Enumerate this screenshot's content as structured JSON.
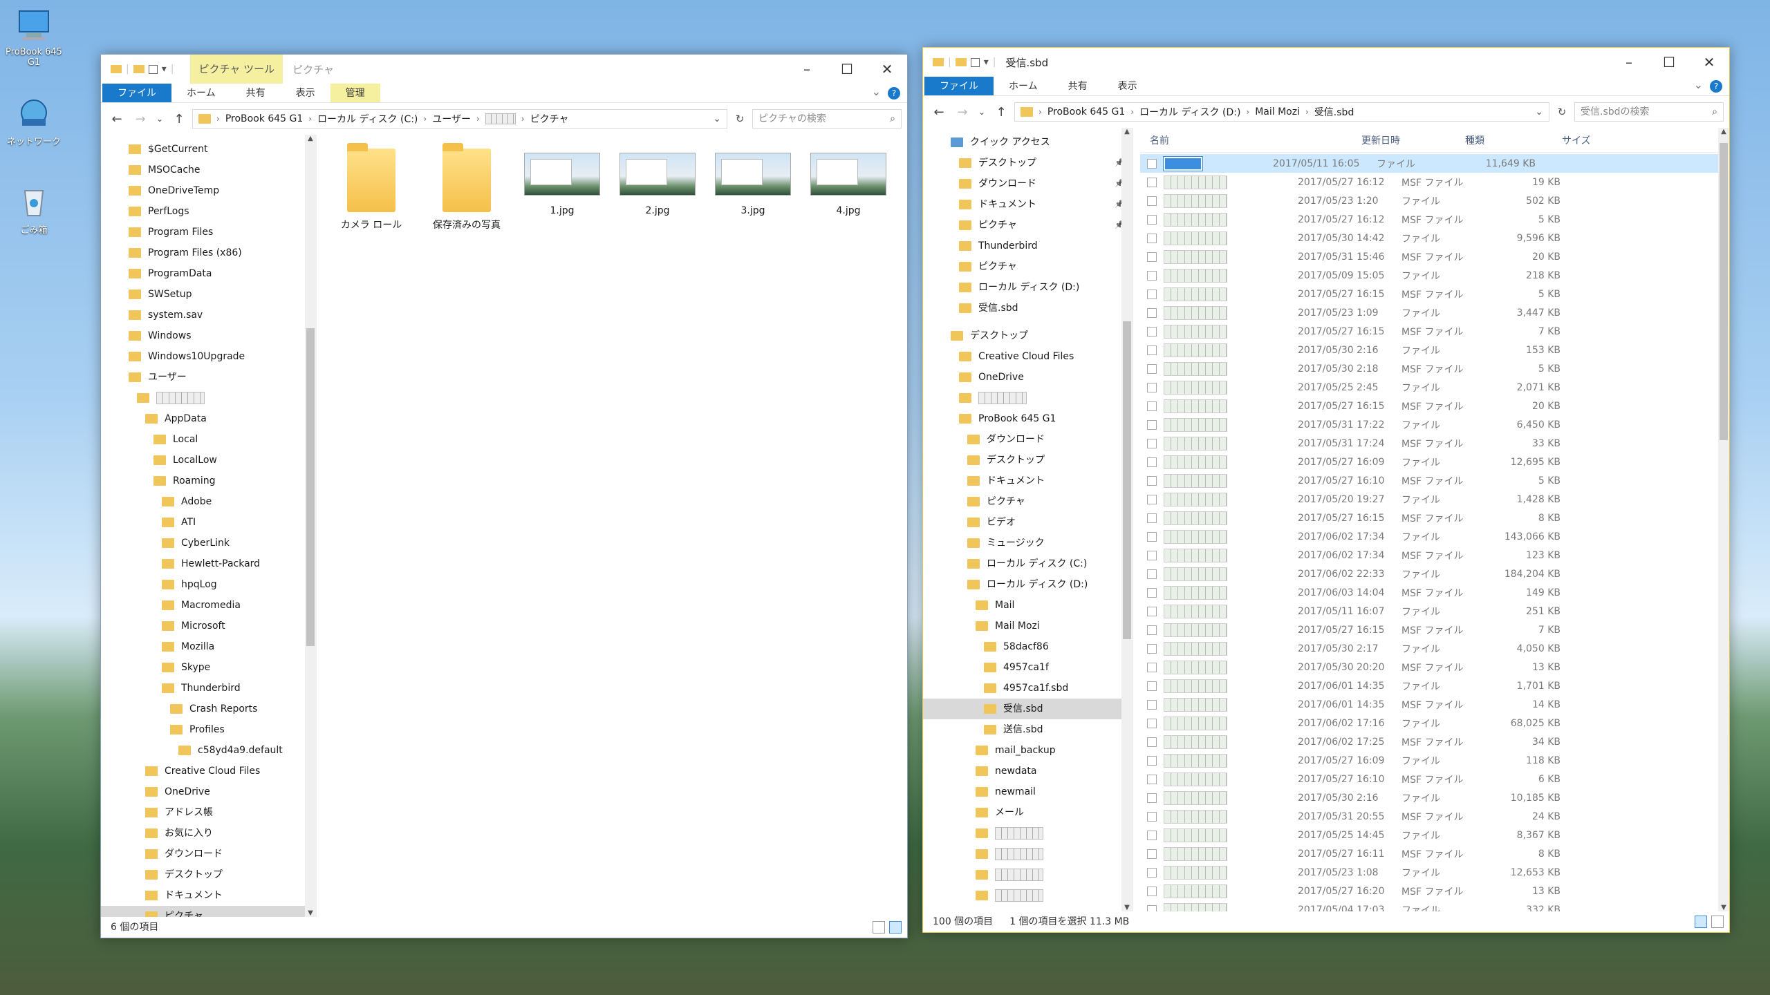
{
  "desktop": {
    "icons": [
      {
        "label": "ProBook 645 G1"
      },
      {
        "label": "ネットワーク"
      },
      {
        "label": "ごみ箱"
      }
    ]
  },
  "left_window": {
    "context_tab": "ピクチャ ツール",
    "title": "ピクチャ",
    "ribbon_tabs": [
      "ファイル",
      "ホーム",
      "共有",
      "表示",
      "管理"
    ],
    "address": [
      "ProBook 645 G1",
      "ローカル ディスク (C:)",
      "ユーザー",
      "ピクチャ"
    ],
    "search_placeholder": "ピクチャの検索",
    "tree": [
      {
        "label": "$GetCurrent",
        "level": 0
      },
      {
        "label": "MSOCache",
        "level": 0
      },
      {
        "label": "OneDriveTemp",
        "level": 0
      },
      {
        "label": "PerfLogs",
        "level": 0
      },
      {
        "label": "Program Files",
        "level": 0
      },
      {
        "label": "Program Files (x86)",
        "level": 0
      },
      {
        "label": "ProgramData",
        "level": 0
      },
      {
        "label": "SWSetup",
        "level": 0
      },
      {
        "label": "system.sav",
        "level": 0
      },
      {
        "label": "Windows",
        "level": 0
      },
      {
        "label": "Windows10Upgrade",
        "level": 0
      },
      {
        "label": "ユーザー",
        "level": 0
      },
      {
        "label": "",
        "level": 1,
        "blurred": true
      },
      {
        "label": "AppData",
        "level": 2
      },
      {
        "label": "Local",
        "level": 3
      },
      {
        "label": "LocalLow",
        "level": 3
      },
      {
        "label": "Roaming",
        "level": 3
      },
      {
        "label": "Adobe",
        "level": 4
      },
      {
        "label": "ATI",
        "level": 4
      },
      {
        "label": "CyberLink",
        "level": 4
      },
      {
        "label": "Hewlett-Packard",
        "level": 4
      },
      {
        "label": "hpqLog",
        "level": 4
      },
      {
        "label": "Macromedia",
        "level": 4
      },
      {
        "label": "Microsoft",
        "level": 4
      },
      {
        "label": "Mozilla",
        "level": 4
      },
      {
        "label": "Skype",
        "level": 4
      },
      {
        "label": "Thunderbird",
        "level": 4
      },
      {
        "label": "Crash Reports",
        "level": 5
      },
      {
        "label": "Profiles",
        "level": 5
      },
      {
        "label": "c58yd4a9.default",
        "level": 6
      },
      {
        "label": "Creative Cloud Files",
        "level": 2
      },
      {
        "label": "OneDrive",
        "level": 2
      },
      {
        "label": "アドレス帳",
        "level": 2
      },
      {
        "label": "お気に入り",
        "level": 2
      },
      {
        "label": "ダウンロード",
        "level": 2
      },
      {
        "label": "デスクトップ",
        "level": 2
      },
      {
        "label": "ドキュメント",
        "level": 2
      },
      {
        "label": "ピクチャ",
        "level": 2,
        "selected": true
      }
    ],
    "items": [
      {
        "label": "カメラ ロール",
        "kind": "folder"
      },
      {
        "label": "保存済みの写真",
        "kind": "folder"
      },
      {
        "label": "1.jpg",
        "kind": "image"
      },
      {
        "label": "2.jpg",
        "kind": "image"
      },
      {
        "label": "3.jpg",
        "kind": "image"
      },
      {
        "label": "4.jpg",
        "kind": "image"
      }
    ],
    "status": "6 個の項目"
  },
  "right_window": {
    "title": "受信.sbd",
    "ribbon_tabs": [
      "ファイル",
      "ホーム",
      "共有",
      "表示"
    ],
    "address": [
      "ProBook 645 G1",
      "ローカル ディスク (D:)",
      "Mail Mozi",
      "受信.sbd"
    ],
    "search_placeholder": "受信.sbdの検索",
    "tree": [
      {
        "label": "クイック アクセス",
        "level": 0,
        "icon": "star"
      },
      {
        "label": "デスクトップ",
        "level": 1,
        "pin": true
      },
      {
        "label": "ダウンロード",
        "level": 1,
        "pin": true
      },
      {
        "label": "ドキュメント",
        "level": 1,
        "pin": true
      },
      {
        "label": "ピクチャ",
        "level": 1,
        "pin": true
      },
      {
        "label": "Thunderbird",
        "level": 1
      },
      {
        "label": "ピクチャ",
        "level": 1
      },
      {
        "label": "ローカル ディスク (D:)",
        "level": 1
      },
      {
        "label": "受信.sbd",
        "level": 1
      },
      {
        "label": "",
        "level": -1
      },
      {
        "label": "デスクトップ",
        "level": 0
      },
      {
        "label": "Creative Cloud Files",
        "level": 1
      },
      {
        "label": "OneDrive",
        "level": 1
      },
      {
        "label": "",
        "level": 1,
        "blurred": true
      },
      {
        "label": "ProBook 645 G1",
        "level": 1
      },
      {
        "label": "ダウンロード",
        "level": 2
      },
      {
        "label": "デスクトップ",
        "level": 2
      },
      {
        "label": "ドキュメント",
        "level": 2
      },
      {
        "label": "ピクチャ",
        "level": 2
      },
      {
        "label": "ビデオ",
        "level": 2
      },
      {
        "label": "ミュージック",
        "level": 2
      },
      {
        "label": "ローカル ディスク (C:)",
        "level": 2
      },
      {
        "label": "ローカル ディスク (D:)",
        "level": 2
      },
      {
        "label": "Mail",
        "level": 3
      },
      {
        "label": "Mail Mozi",
        "level": 3
      },
      {
        "label": "58dacf86",
        "level": 4
      },
      {
        "label": "4957ca1f",
        "level": 4
      },
      {
        "label": "4957ca1f.sbd",
        "level": 4
      },
      {
        "label": "受信.sbd",
        "level": 4,
        "selected": true
      },
      {
        "label": "送信.sbd",
        "level": 4
      },
      {
        "label": "mail_backup",
        "level": 3
      },
      {
        "label": "newdata",
        "level": 3
      },
      {
        "label": "newmail",
        "level": 3
      },
      {
        "label": "メール",
        "level": 3
      },
      {
        "label": "",
        "level": 3,
        "blurred": true
      },
      {
        "label": "",
        "level": 3,
        "blurred": true
      },
      {
        "label": "",
        "level": 3,
        "blurred": true
      },
      {
        "label": "",
        "level": 3,
        "blurred": true
      }
    ],
    "columns": {
      "name": "名前",
      "date": "更新日時",
      "type": "種類",
      "size": "サイズ"
    },
    "rows": [
      {
        "date": "2017/05/11 16:05",
        "type": "ファイル",
        "size": "11,649 KB",
        "selected": true
      },
      {
        "date": "2017/05/27 16:12",
        "type": "MSF ファイル",
        "size": "19 KB"
      },
      {
        "date": "2017/05/23 1:20",
        "type": "ファイル",
        "size": "502 KB"
      },
      {
        "date": "2017/05/27 16:12",
        "type": "MSF ファイル",
        "size": "5 KB"
      },
      {
        "date": "2017/05/30 14:42",
        "type": "ファイル",
        "size": "9,596 KB"
      },
      {
        "date": "2017/05/31 15:46",
        "type": "MSF ファイル",
        "size": "20 KB"
      },
      {
        "date": "2017/05/09 15:05",
        "type": "ファイル",
        "size": "218 KB"
      },
      {
        "date": "2017/05/27 16:15",
        "type": "MSF ファイル",
        "size": "5 KB"
      },
      {
        "date": "2017/05/23 1:09",
        "type": "ファイル",
        "size": "3,447 KB"
      },
      {
        "date": "2017/05/27 16:15",
        "type": "MSF ファイル",
        "size": "7 KB"
      },
      {
        "date": "2017/05/30 2:16",
        "type": "ファイル",
        "size": "153 KB"
      },
      {
        "date": "2017/05/30 2:18",
        "type": "MSF ファイル",
        "size": "5 KB"
      },
      {
        "date": "2017/05/25 2:45",
        "type": "ファイル",
        "size": "2,071 KB"
      },
      {
        "date": "2017/05/27 16:15",
        "type": "MSF ファイル",
        "size": "20 KB"
      },
      {
        "date": "2017/05/31 17:22",
        "type": "ファイル",
        "size": "6,450 KB"
      },
      {
        "date": "2017/05/31 17:24",
        "type": "MSF ファイル",
        "size": "33 KB"
      },
      {
        "date": "2017/05/27 16:09",
        "type": "ファイル",
        "size": "12,695 KB"
      },
      {
        "date": "2017/05/27 16:10",
        "type": "MSF ファイル",
        "size": "5 KB"
      },
      {
        "date": "2017/05/20 19:27",
        "type": "ファイル",
        "size": "1,428 KB"
      },
      {
        "date": "2017/05/27 16:15",
        "type": "MSF ファイル",
        "size": "8 KB"
      },
      {
        "date": "2017/06/02 17:34",
        "type": "ファイル",
        "size": "143,066 KB"
      },
      {
        "date": "2017/06/02 17:34",
        "type": "MSF ファイル",
        "size": "123 KB"
      },
      {
        "date": "2017/06/02 22:33",
        "type": "ファイル",
        "size": "184,204 KB"
      },
      {
        "date": "2017/06/03 14:04",
        "type": "MSF ファイル",
        "size": "149 KB"
      },
      {
        "date": "2017/05/11 16:07",
        "type": "ファイル",
        "size": "251 KB"
      },
      {
        "date": "2017/05/27 16:15",
        "type": "MSF ファイル",
        "size": "7 KB"
      },
      {
        "date": "2017/05/30 2:17",
        "type": "ファイル",
        "size": "4,050 KB"
      },
      {
        "date": "2017/05/30 20:20",
        "type": "MSF ファイル",
        "size": "13 KB"
      },
      {
        "date": "2017/06/01 14:35",
        "type": "ファイル",
        "size": "1,701 KB"
      },
      {
        "date": "2017/06/01 14:35",
        "type": "MSF ファイル",
        "size": "14 KB"
      },
      {
        "date": "2017/06/02 17:16",
        "type": "ファイル",
        "size": "68,025 KB"
      },
      {
        "date": "2017/06/02 17:25",
        "type": "MSF ファイル",
        "size": "34 KB"
      },
      {
        "date": "2017/05/27 16:09",
        "type": "ファイル",
        "size": "118 KB"
      },
      {
        "date": "2017/05/27 16:10",
        "type": "MSF ファイル",
        "size": "6 KB"
      },
      {
        "date": "2017/05/30 2:16",
        "type": "ファイル",
        "size": "10,185 KB"
      },
      {
        "date": "2017/05/31 20:55",
        "type": "MSF ファイル",
        "size": "24 KB"
      },
      {
        "date": "2017/05/25 14:45",
        "type": "ファイル",
        "size": "8,367 KB"
      },
      {
        "date": "2017/05/27 16:11",
        "type": "MSF ファイル",
        "size": "8 KB"
      },
      {
        "date": "2017/05/23 1:08",
        "type": "ファイル",
        "size": "12,653 KB"
      },
      {
        "date": "2017/05/27 16:20",
        "type": "MSF ファイル",
        "size": "13 KB"
      },
      {
        "date": "2017/05/04 17:03",
        "type": "ファイル",
        "size": "332 KB"
      }
    ],
    "status_count": "100 個の項目",
    "status_selected": "1 個の項目を選択 11.3 MB"
  }
}
